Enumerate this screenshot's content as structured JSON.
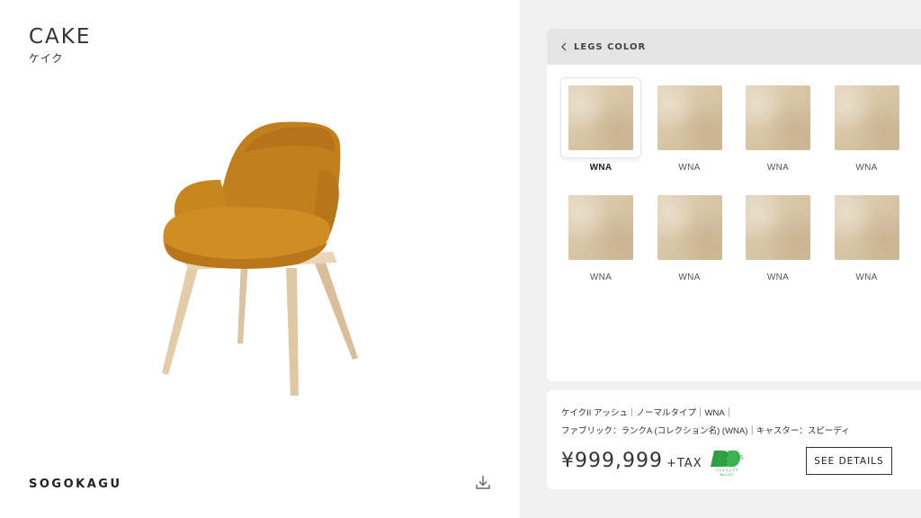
{
  "product": {
    "name": "CAKE",
    "name_kana": "ケイク"
  },
  "brand": {
    "logo_text": "SOGOKAGU"
  },
  "icons": {
    "download": "download-icon",
    "back": "chevron-left-icon",
    "certification": "biomass-mark-icon"
  },
  "panel": {
    "title": "LEGS COLOR",
    "swatches": [
      {
        "label": "WNA",
        "selected": true
      },
      {
        "label": "WNA",
        "selected": false
      },
      {
        "label": "WNA",
        "selected": false
      },
      {
        "label": "WNA",
        "selected": false
      },
      {
        "label": "WNA",
        "selected": false
      },
      {
        "label": "WNA",
        "selected": false
      },
      {
        "label": "WNA",
        "selected": false
      },
      {
        "label": "WNA",
        "selected": false
      }
    ]
  },
  "info": {
    "spec_line1": "ケイクII アッシュ｜ノーマルタイプ｜WNA｜",
    "spec_line2": "ファブリック：ランクA (コレクション名) (WNA)｜キャスター：スピーディ",
    "price": "¥999,999",
    "tax_label": "+TAX",
    "badge_text": "バイオマスプラ",
    "badge_number": "No.1157",
    "badge_code": "25",
    "details_button": "SEE DETAILS"
  },
  "colors": {
    "fabric": "#c9861f",
    "wood": "#e6d2b3",
    "badge_green": "#2ea043"
  }
}
